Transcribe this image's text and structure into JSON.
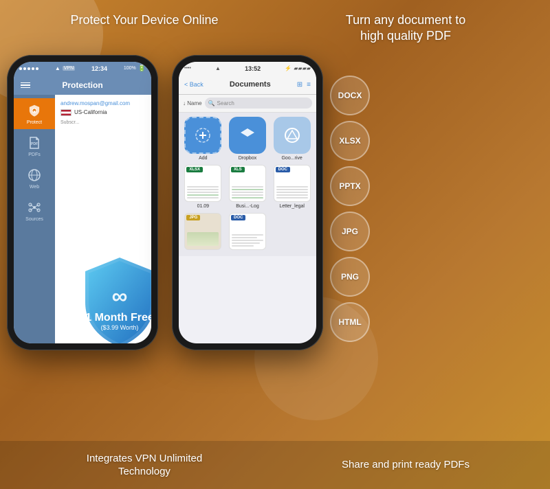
{
  "header": {
    "left_title": "Protect Your Device\nOnline",
    "right_title": "Turn any document to\nhigh quality PDF"
  },
  "footer": {
    "left_text": "Integrates VPN Unlimited\nTechnology",
    "right_text": "Share and print ready PDFs"
  },
  "phone1": {
    "status_bar": {
      "dots": "•••••",
      "wifi": "wifi",
      "vpn": "VPN",
      "time": "12:34",
      "battery": "100%"
    },
    "nav_title": "Protection",
    "user_email": "andrew.mospan@gmail.com",
    "user_location": "US-California",
    "subscribe_label": "Subscr...",
    "shield_text_line1": "1 Month Free",
    "shield_text_line2": "($3.99 Worth)",
    "sidebar_items": [
      {
        "label": "Protect",
        "active": true
      },
      {
        "label": "PDFs",
        "active": false
      },
      {
        "label": "Web",
        "active": false
      },
      {
        "label": "Sources",
        "active": false
      }
    ]
  },
  "phone2": {
    "status_bar": {
      "dots": "••••",
      "wifi": "wifi",
      "time": "13:52",
      "bt": "bt"
    },
    "back_label": "< Back",
    "nav_title": "Documents",
    "toolbar": {
      "sort_label": "↓ Name",
      "search_placeholder": "Search"
    },
    "grid_items": [
      {
        "type": "add",
        "label": "Add"
      },
      {
        "type": "dropbox",
        "label": "Dropbox"
      },
      {
        "type": "google",
        "label": "Goo...rive"
      },
      {
        "type": "xlsx_file",
        "label": "01.09",
        "badge": "XLSX"
      },
      {
        "type": "xls_file",
        "label": "Busi...-Log",
        "badge": "XLS"
      },
      {
        "type": "doc_file",
        "label": "Letter_legal",
        "badge": "DOC"
      },
      {
        "type": "jpg_file",
        "label": "",
        "badge": "JPG"
      },
      {
        "type": "doc_file2",
        "label": "",
        "badge": "DOC"
      }
    ]
  },
  "format_badges": [
    "DOCX",
    "XLSX",
    "PPTX",
    "JPG",
    "PNG",
    "HTML"
  ]
}
